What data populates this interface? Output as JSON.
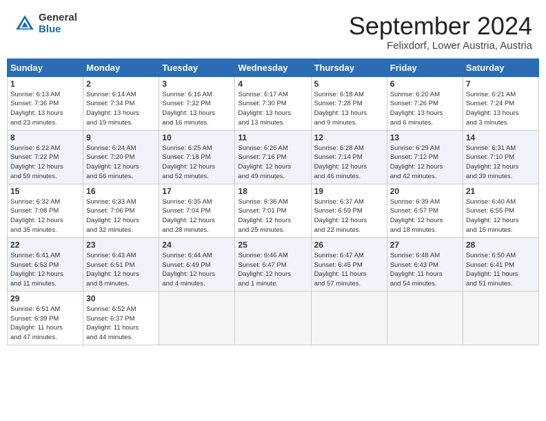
{
  "header": {
    "logo_general": "General",
    "logo_blue": "Blue",
    "month_title": "September 2024",
    "location": "Felixdorf, Lower Austria, Austria"
  },
  "days_of_week": [
    "Sunday",
    "Monday",
    "Tuesday",
    "Wednesday",
    "Thursday",
    "Friday",
    "Saturday"
  ],
  "weeks": [
    [
      {
        "day": "1",
        "info": "Sunrise: 6:13 AM\nSunset: 7:36 PM\nDaylight: 13 hours\nand 23 minutes."
      },
      {
        "day": "2",
        "info": "Sunrise: 6:14 AM\nSunset: 7:34 PM\nDaylight: 13 hours\nand 19 minutes."
      },
      {
        "day": "3",
        "info": "Sunrise: 6:16 AM\nSunset: 7:32 PM\nDaylight: 13 hours\nand 16 minutes."
      },
      {
        "day": "4",
        "info": "Sunrise: 6:17 AM\nSunset: 7:30 PM\nDaylight: 13 hours\nand 13 minutes."
      },
      {
        "day": "5",
        "info": "Sunrise: 6:18 AM\nSunset: 7:28 PM\nDaylight: 13 hours\nand 9 minutes."
      },
      {
        "day": "6",
        "info": "Sunrise: 6:20 AM\nSunset: 7:26 PM\nDaylight: 13 hours\nand 6 minutes."
      },
      {
        "day": "7",
        "info": "Sunrise: 6:21 AM\nSunset: 7:24 PM\nDaylight: 13 hours\nand 3 minutes."
      }
    ],
    [
      {
        "day": "8",
        "info": "Sunrise: 6:22 AM\nSunset: 7:22 PM\nDaylight: 12 hours\nand 59 minutes."
      },
      {
        "day": "9",
        "info": "Sunrise: 6:24 AM\nSunset: 7:20 PM\nDaylight: 12 hours\nand 56 minutes."
      },
      {
        "day": "10",
        "info": "Sunrise: 6:25 AM\nSunset: 7:18 PM\nDaylight: 12 hours\nand 52 minutes."
      },
      {
        "day": "11",
        "info": "Sunrise: 6:26 AM\nSunset: 7:16 PM\nDaylight: 12 hours\nand 49 minutes."
      },
      {
        "day": "12",
        "info": "Sunrise: 6:28 AM\nSunset: 7:14 PM\nDaylight: 12 hours\nand 46 minutes."
      },
      {
        "day": "13",
        "info": "Sunrise: 6:29 AM\nSunset: 7:12 PM\nDaylight: 12 hours\nand 42 minutes."
      },
      {
        "day": "14",
        "info": "Sunrise: 6:31 AM\nSunset: 7:10 PM\nDaylight: 12 hours\nand 39 minutes."
      }
    ],
    [
      {
        "day": "15",
        "info": "Sunrise: 6:32 AM\nSunset: 7:08 PM\nDaylight: 12 hours\nand 35 minutes."
      },
      {
        "day": "16",
        "info": "Sunrise: 6:33 AM\nSunset: 7:06 PM\nDaylight: 12 hours\nand 32 minutes."
      },
      {
        "day": "17",
        "info": "Sunrise: 6:35 AM\nSunset: 7:04 PM\nDaylight: 12 hours\nand 28 minutes."
      },
      {
        "day": "18",
        "info": "Sunrise: 6:36 AM\nSunset: 7:01 PM\nDaylight: 12 hours\nand 25 minutes."
      },
      {
        "day": "19",
        "info": "Sunrise: 6:37 AM\nSunset: 6:59 PM\nDaylight: 12 hours\nand 22 minutes."
      },
      {
        "day": "20",
        "info": "Sunrise: 6:39 AM\nSunset: 6:57 PM\nDaylight: 12 hours\nand 18 minutes."
      },
      {
        "day": "21",
        "info": "Sunrise: 6:40 AM\nSunset: 6:55 PM\nDaylight: 12 hours\nand 15 minutes."
      }
    ],
    [
      {
        "day": "22",
        "info": "Sunrise: 6:41 AM\nSunset: 6:53 PM\nDaylight: 12 hours\nand 11 minutes."
      },
      {
        "day": "23",
        "info": "Sunrise: 6:43 AM\nSunset: 6:51 PM\nDaylight: 12 hours\nand 8 minutes."
      },
      {
        "day": "24",
        "info": "Sunrise: 6:44 AM\nSunset: 6:49 PM\nDaylight: 12 hours\nand 4 minutes."
      },
      {
        "day": "25",
        "info": "Sunrise: 6:46 AM\nSunset: 6:47 PM\nDaylight: 12 hours\nand 1 minute."
      },
      {
        "day": "26",
        "info": "Sunrise: 6:47 AM\nSunset: 6:45 PM\nDaylight: 11 hours\nand 57 minutes."
      },
      {
        "day": "27",
        "info": "Sunrise: 6:48 AM\nSunset: 6:43 PM\nDaylight: 11 hours\nand 54 minutes."
      },
      {
        "day": "28",
        "info": "Sunrise: 6:50 AM\nSunset: 6:41 PM\nDaylight: 11 hours\nand 51 minutes."
      }
    ],
    [
      {
        "day": "29",
        "info": "Sunrise: 6:51 AM\nSunset: 6:39 PM\nDaylight: 11 hours\nand 47 minutes."
      },
      {
        "day": "30",
        "info": "Sunrise: 6:52 AM\nSunset: 6:37 PM\nDaylight: 11 hours\nand 44 minutes."
      },
      {
        "day": "",
        "info": ""
      },
      {
        "day": "",
        "info": ""
      },
      {
        "day": "",
        "info": ""
      },
      {
        "day": "",
        "info": ""
      },
      {
        "day": "",
        "info": ""
      }
    ]
  ]
}
